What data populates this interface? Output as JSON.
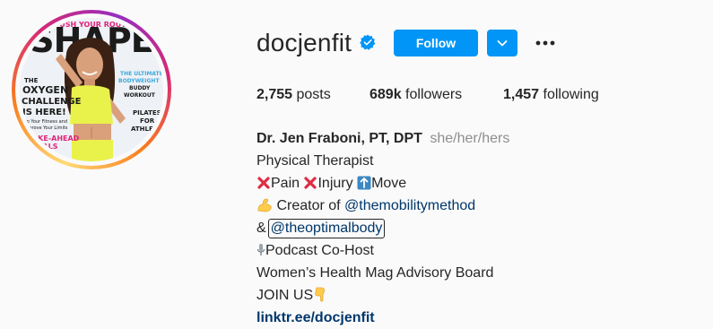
{
  "profile": {
    "username": "docjenfit",
    "follow_label": "Follow",
    "stats": {
      "posts_count": "2,755",
      "posts_label": "posts",
      "followers_count": "689k",
      "followers_label": "followers",
      "following_count": "1,457",
      "following_label": "following"
    },
    "bio": {
      "full_name": "Dr. Jen Fraboni, PT, DPT",
      "pronouns": "she/her/hers",
      "category": "Physical Therapist",
      "line_pain": "Pain",
      "line_injury": "Injury",
      "line_move": "Move",
      "creator_prefix": "Creator of",
      "creator_handle": "@themobilitymethod",
      "amp": "&",
      "optimal_handle": "@theoptimalbody",
      "podcast": "Podcast Co-Host",
      "advisory": "Women’s Health Mag Advisory Board",
      "join": "JOIN US",
      "external_link": "linktr.ee/docjenfit"
    },
    "avatar": {
      "masthead": "SHAPE",
      "cover_headline_top": "PUSH YOUR ROUTI",
      "cover_left_1": "THE",
      "cover_left_2": "OXYGEN",
      "cover_left_3": "CHALLENGE",
      "cover_left_4": "IS HERE!",
      "cover_left_5": "Up Your Fitness and",
      "cover_left_6": "Improve Your Limits",
      "cover_left_7": "MAKE-AHEAD",
      "cover_left_8": "MEALS",
      "cover_right_1": "THE ULTIMATE",
      "cover_right_2": "BODYWEIGHT",
      "cover_right_3": "BUDDY",
      "cover_right_4": "WORKOUT",
      "cover_right_5": "PILATES",
      "cover_right_6": "FOR",
      "cover_right_7": "ATHLETES"
    }
  },
  "colors": {
    "primary_button": "#0095f6",
    "link": "#00376b",
    "muted": "#8e8e8e",
    "text": "#262626",
    "cross_emoji": "#dd2e44",
    "arrow_emoji": "#3b88c3",
    "muscle_emoji": "#ffcc4d"
  },
  "icons": {
    "verified": "verified-badge-icon",
    "dropdown": "chevron-down-icon",
    "more": "more-options-icon",
    "cross": "cross-mark-icon",
    "up_arrow": "up-arrow-icon",
    "muscle": "flexed-biceps-icon",
    "microphone": "microphone-icon",
    "pointing_down": "backhand-index-pointing-down-icon"
  }
}
